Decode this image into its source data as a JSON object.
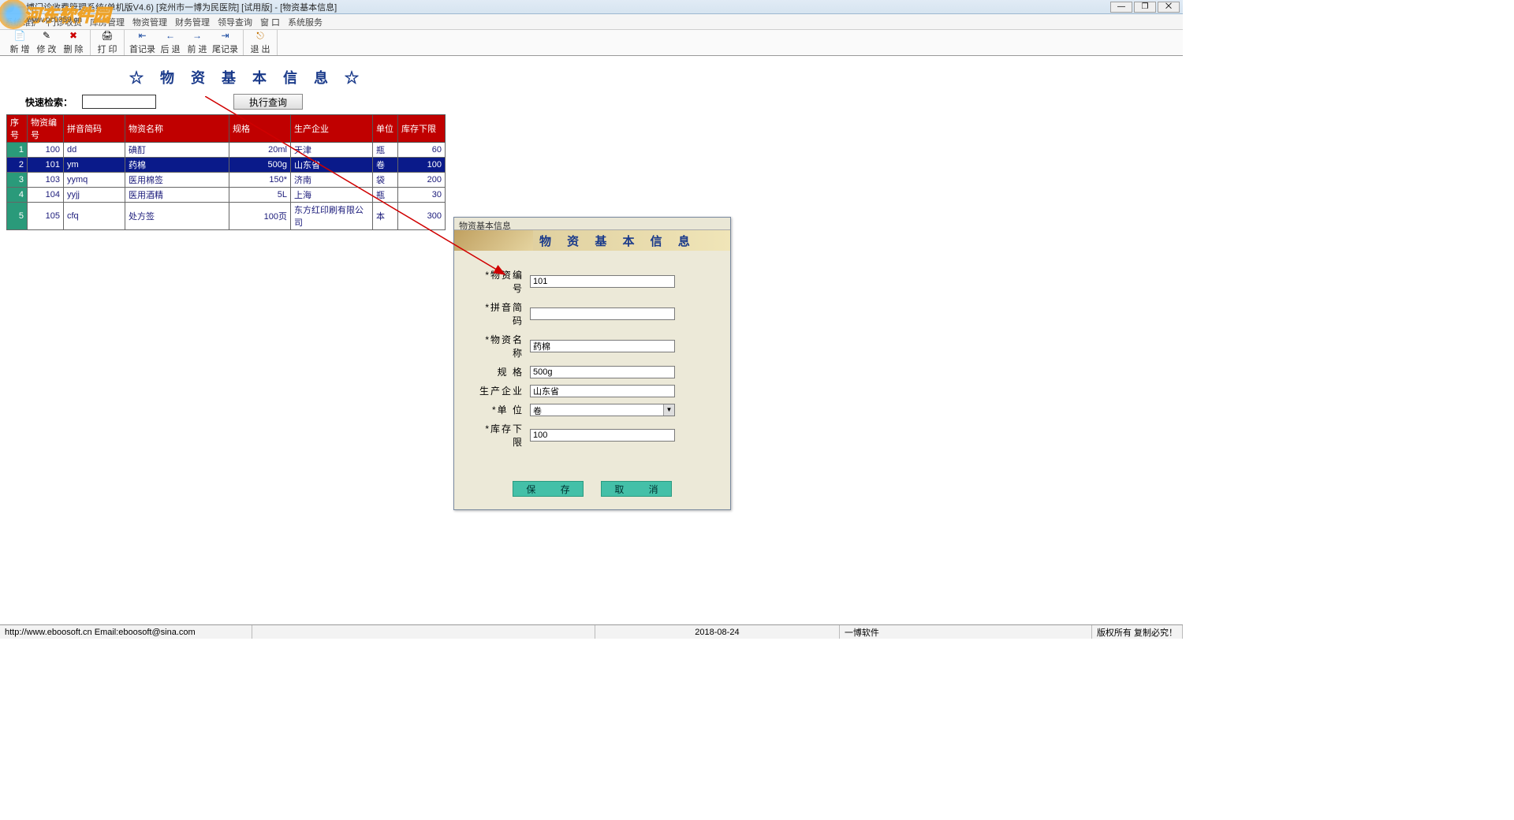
{
  "window": {
    "title": "一博门诊收费管理系统(单机版V4.6)    [兖州市一博为民医院]  [试用版] - [物资基本信息]"
  },
  "watermark": {
    "text": "河东软件园",
    "sub": "www.pc0359.cn"
  },
  "menu": [
    "系统维护",
    "门诊收费",
    "库房管理",
    "物资管理",
    "财务管理",
    "领导查询",
    "窗  口",
    "系统服务"
  ],
  "toolbar": {
    "new": "新 增",
    "edit": "修 改",
    "del": "删 除",
    "print": "打 印",
    "first": "首记录",
    "prev": "后 退",
    "next": "前 进",
    "last": "尾记录",
    "exit": "退 出"
  },
  "page": {
    "title": "☆ 物 资 基 本 信 息 ☆",
    "search_label": "快速检索：",
    "exec_btn": "执行查询"
  },
  "table": {
    "headers": [
      "序号",
      "物资编号",
      "拼音简码",
      "物资名称",
      "规格",
      "生产企业",
      "单位",
      "库存下限"
    ],
    "rows": [
      {
        "n": "1",
        "code": "100",
        "py": "dd",
        "name": "碘酊",
        "spec": "20ml",
        "mfr": "天津",
        "unit": "瓶",
        "min": "60"
      },
      {
        "n": "2",
        "code": "101",
        "py": "ym",
        "name": "药棉",
        "spec": "500g",
        "mfr": "山东省",
        "unit": "卷",
        "min": "100"
      },
      {
        "n": "3",
        "code": "103",
        "py": "yymq",
        "name": "医用棉签",
        "spec": "150*",
        "mfr": "济南",
        "unit": "袋",
        "min": "200"
      },
      {
        "n": "4",
        "code": "104",
        "py": "yyjj",
        "name": "医用酒精",
        "spec": "5L",
        "mfr": "上海",
        "unit": "瓶",
        "min": "30"
      },
      {
        "n": "5",
        "code": "105",
        "py": "cfq",
        "name": "处方签",
        "spec": "100页",
        "mfr": "东方红印刷有限公司",
        "unit": "本",
        "min": "300"
      }
    ],
    "selected": 1
  },
  "dialog": {
    "title": "物资基本信息",
    "banner": "物 资 基 本 信 息",
    "fields": {
      "code": {
        "label": "*物资编号",
        "value": "101"
      },
      "py": {
        "label": "*拼音简码",
        "value": ""
      },
      "name": {
        "label": "*物资名称",
        "value": "药棉"
      },
      "spec": {
        "label": "规      格",
        "value": "500g"
      },
      "mfr": {
        "label": "生产企业",
        "value": "山东省"
      },
      "unit": {
        "label": "*单      位",
        "value": "卷"
      },
      "min": {
        "label": "*库存下限",
        "value": "100"
      }
    },
    "save": "保      存",
    "cancel": "取      消"
  },
  "status": {
    "left": "http://www.eboosoft.cn    Email:eboosoft@sina.com",
    "date": "2018-08-24",
    "company": "一博软件",
    "right": "版权所有  复制必究！"
  }
}
